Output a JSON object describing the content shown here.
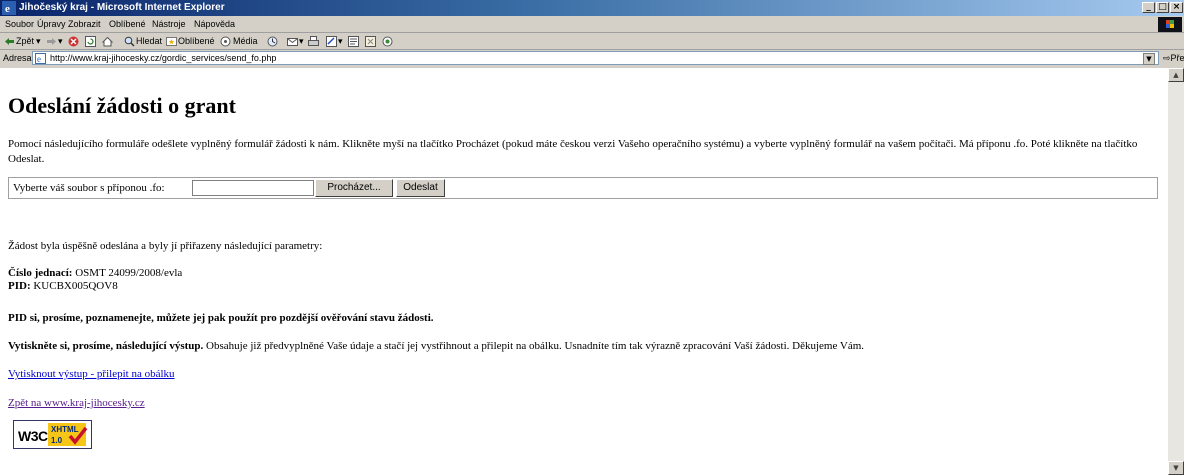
{
  "window": {
    "title": "Jihočeský kraj - Microsoft Internet Explorer",
    "minimize": "_",
    "maximize": "□",
    "close": "×"
  },
  "menu": [
    "Soubor",
    "Úpravy",
    "Zobrazit",
    "Oblíbené",
    "Nástroje",
    "Nápověda"
  ],
  "toolbar": {
    "back": "Zpět",
    "search": "Hledat",
    "favorites": "Oblíbené",
    "media": "Média"
  },
  "address": {
    "label": "Adresa",
    "url": "http://www.kraj-jihocesky.cz/gordic_services/send_fo.php",
    "go": "Přejít"
  },
  "page": {
    "heading": "Odeslání žádosti o grant",
    "intro": "Pomocí následujícího formuláře odešlete vyplněný formulář žádosti k nám. Klikněte myší na tlačítko Procházet (pokud máte českou verzi Vašeho operačního systému) a vyberte vyplněný formulář na vašem počítači. Má příponu .fo. Poté klikněte na tlačítko Odeslat.",
    "form": {
      "label": "Vyberte váš soubor s příponou .fo:",
      "file_value": "",
      "browse_label": "Procházet...",
      "submit_label": "Odeslat"
    },
    "success_msg": "Žádost byla úspěšně odeslána a byly jí přiřazeny následující parametry:",
    "ref_label": "Číslo jednací:",
    "ref_value": "OSMT 24099/2008/evla",
    "pid_label": "PID:",
    "pid_value": "KUCBX005QOV8",
    "pid_note": "PID si, prosíme, poznamenejte, můžete jej pak použít pro pozdější ověřování stavu žádosti.",
    "print_bold": "Vytiskněte si, prosíme, následující výstup.",
    "print_text": "Obsahuje již předvyplněné Vaše údaje a stačí jej vystřihnout a přilepit na obálku. Usnadníte tím tak výrazně zpracování Vaší žádosti. Děkujeme Vám.",
    "print_link": "Vytisknout výstup - přilepit na obálku",
    "back_link": "Zpět na www.kraj-jihocesky.cz",
    "badge": {
      "w3c": "W3C",
      "xhtml": "XHTML",
      "version": "1.0"
    }
  }
}
